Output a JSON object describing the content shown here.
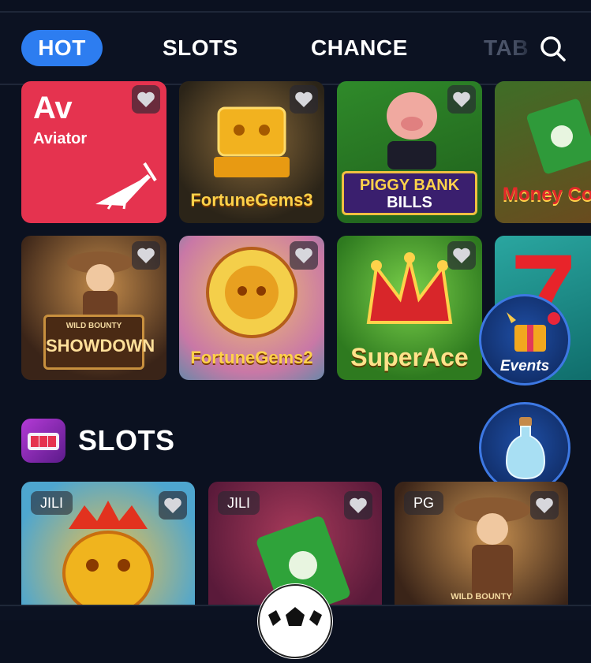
{
  "nav": {
    "tabs": [
      {
        "label": "HOT",
        "active": true
      },
      {
        "label": "SLOTS",
        "active": false
      },
      {
        "label": "CHANCE",
        "active": false
      },
      {
        "label": "TAB",
        "active": false
      }
    ],
    "search_icon": "search-icon"
  },
  "hot": {
    "aviator": {
      "code": "Av",
      "name": "Aviator"
    },
    "fortune_gems_3": {
      "title": "FortuneGems3"
    },
    "piggy_bank": {
      "title_line1": "PIGGY BANK",
      "title_line2": "BILLS"
    },
    "money": {
      "title": "Money Co"
    },
    "showdown": {
      "title_small": "WILD BOUNTY",
      "title": "SHOWDOWN"
    },
    "fortune_gems_2": {
      "title": "FortuneGems2"
    },
    "super_ace": {
      "title": "SuperAce"
    },
    "seven": {
      "title": "7"
    }
  },
  "floating": {
    "events_label": "Events",
    "bottle_icon": "bottle-icon"
  },
  "slots_section": {
    "title": "SLOTS",
    "games": [
      {
        "provider": "JILI"
      },
      {
        "provider": "JILI"
      },
      {
        "provider": "PG",
        "title_small": "WILD BOUNTY"
      }
    ]
  },
  "colors": {
    "background": "#0b1120",
    "accent": "#2d7df0",
    "aviator_red": "#e5334f"
  }
}
